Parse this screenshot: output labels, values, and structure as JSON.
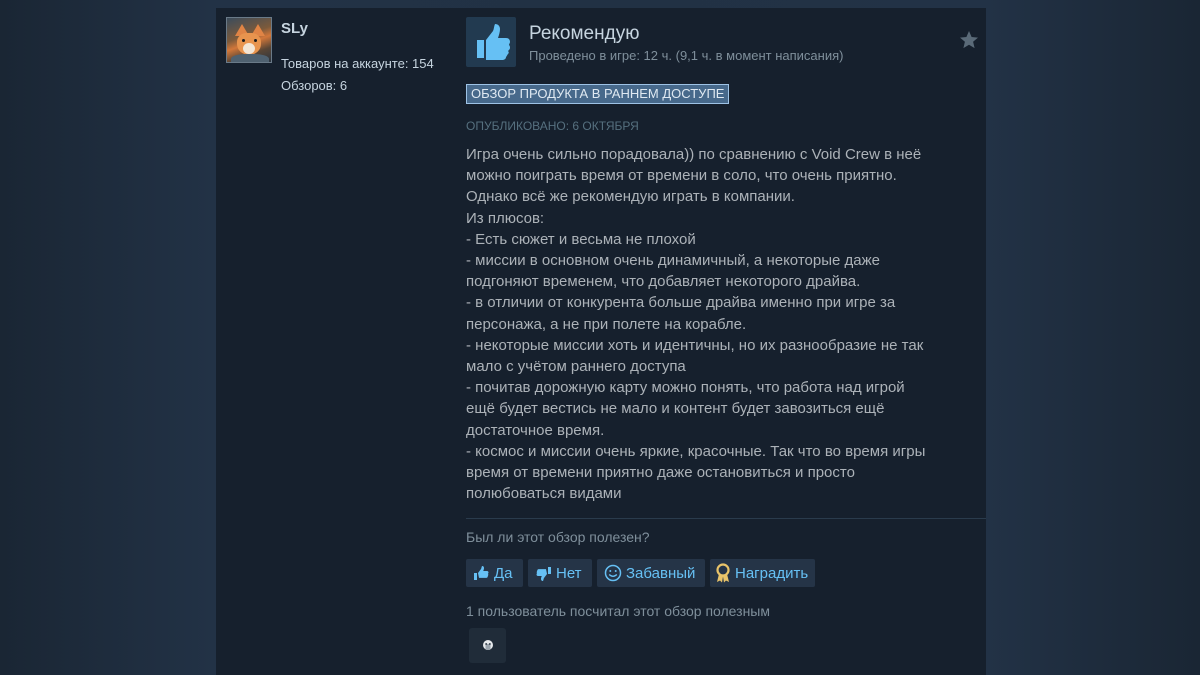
{
  "author": {
    "name": "SLy",
    "products_label": "Товаров на аккаунте: 154",
    "reviews_label": "Обзоров: 6"
  },
  "review": {
    "verdict": "Рекомендую",
    "playtime": "Проведено в игре: 12 ч. (9,1 ч. в момент написания)",
    "early_access_badge": "ОБЗОР ПРОДУКТА В РАННЕМ ДОСТУПЕ",
    "posted": "ОПУБЛИКОВАНО: 6 ОКТЯБРЯ",
    "text_lines": [
      "Игра очень сильно порадовала)) по сравнению с Void Crew в неё",
      "можно поиграть время от времени в соло, что очень приятно.",
      "Однако всё же рекомендую играть в компании.",
      "Из плюсов:",
      "- Есть сюжет и весьма не плохой",
      "- миссии в основном очень динамичный, а некоторые даже",
      "подгоняют временем, что добавляет некоторого драйва.",
      "- в отличии от конкурента больше драйва именно при игре за",
      "персонажа, а не при полете на корабле.",
      "- некоторые миссии хоть и идентичны, но их разнообразие не так",
      "мало с учётом раннего доступа",
      "- почитав дорожную карту можно понять, что работа над игрой",
      "ещё будет вестись не мало и контент будет завозиться ещё",
      "достаточное время.",
      "- космос и миссии очень яркие, красочные. Так что во время игры",
      "время от времени приятно даже остановиться и просто",
      "полюбоваться видами"
    ]
  },
  "feedback": {
    "question": "Был ли этот обзор полезен?",
    "yes_label": "Да",
    "no_label": "Нет",
    "funny_label": "Забавный",
    "award_label": "Наградить",
    "helpful_count": "1 пользователь посчитал этот обзор полезным"
  },
  "icons": {
    "verdict": "thumbs-up-icon",
    "award_star": "star-icon",
    "yes": "thumbs-up-icon",
    "no": "thumbs-down-icon",
    "funny": "smiley-icon",
    "award": "award-ribbon-icon",
    "reaction": "award-reaction-icon"
  },
  "colors": {
    "link_blue": "#66c0f4",
    "text": "#acb2b8",
    "card_bg": "#16202d",
    "badge_bg": "#47698b"
  }
}
